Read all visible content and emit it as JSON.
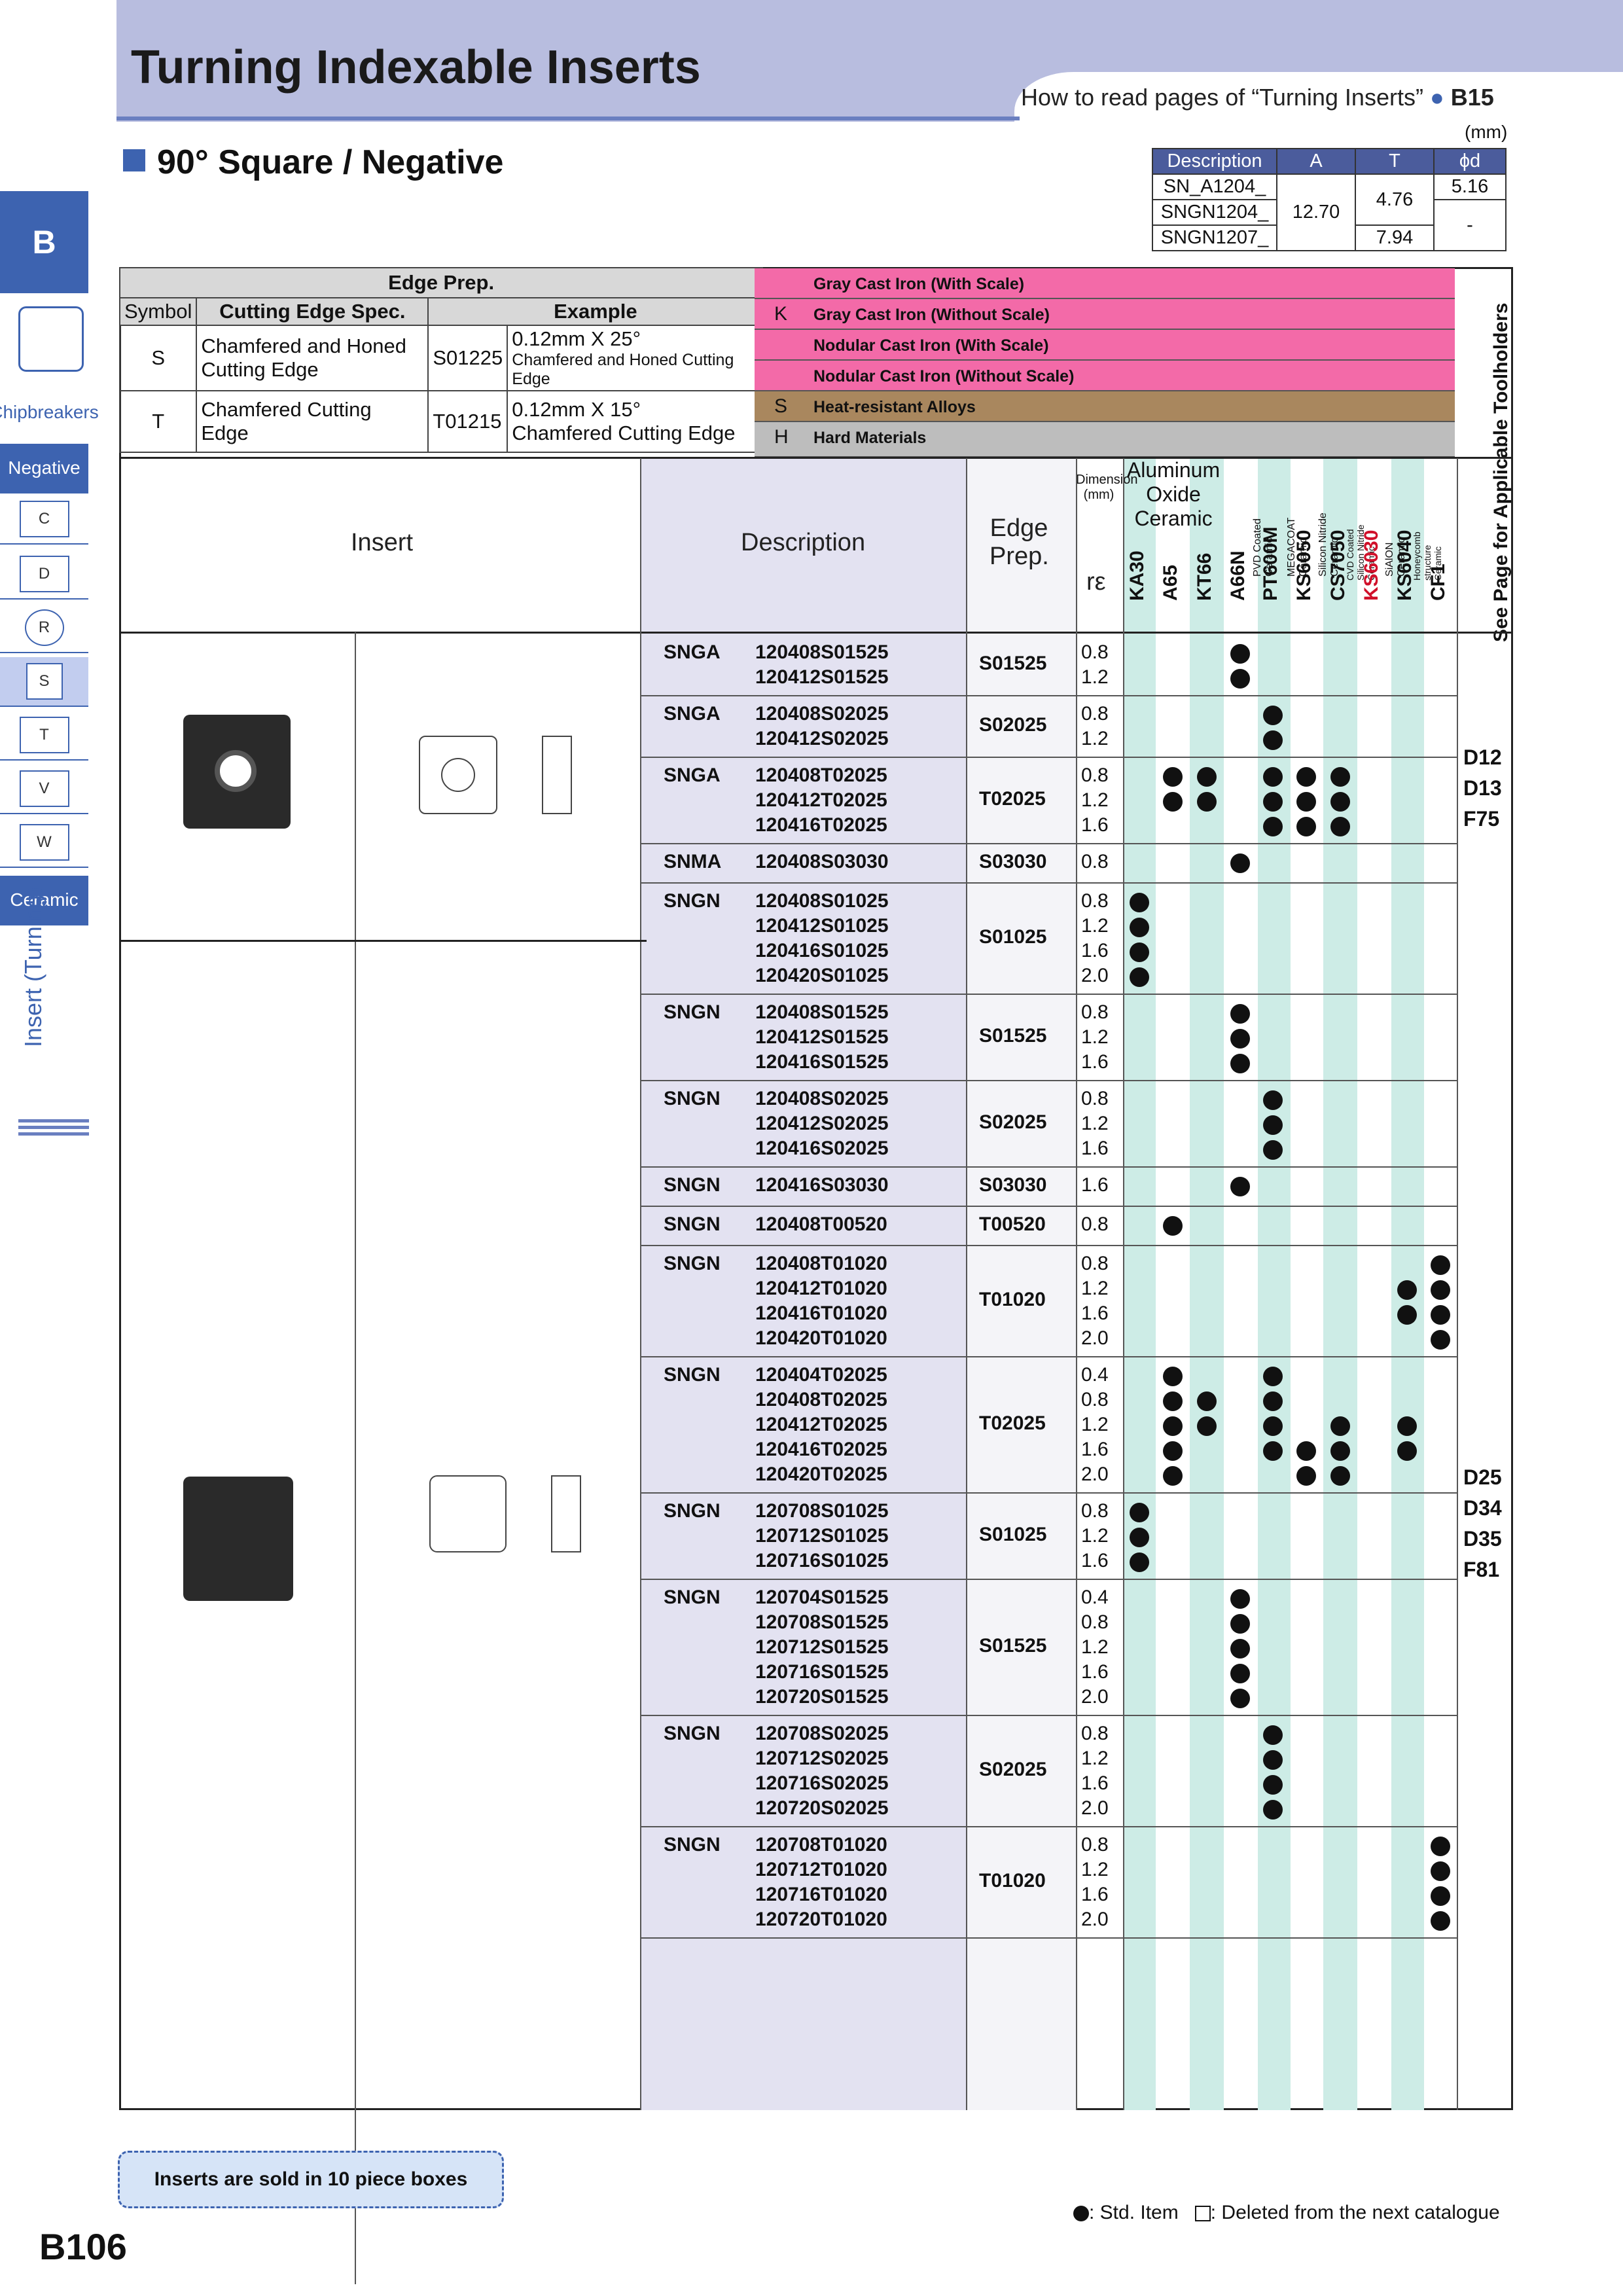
{
  "header": {
    "title": "Turning Indexable Inserts",
    "howto": "How to read pages of “Turning Inserts”",
    "howto_ref": "B15",
    "section": "90° Square / Negative",
    "unit": "(mm)"
  },
  "dims": {
    "headers": [
      "Description",
      "A",
      "T",
      "ϕd"
    ],
    "rows": [
      [
        "SN_A1204_",
        "12.70",
        "4.76",
        "5.16"
      ],
      [
        "SNGN1204_",
        "",
        "",
        "-"
      ],
      [
        "SNGN1207_",
        "",
        "7.94",
        ""
      ]
    ]
  },
  "sidebar": {
    "tab": "B",
    "chipbreakers": "Chipbreakers",
    "negative": "Negative",
    "shapes": [
      "C",
      "D",
      "R",
      "S",
      "T",
      "V",
      "W"
    ],
    "ceramic": "Ceramic",
    "vertical": "Insert (Turning)"
  },
  "edgeprep": {
    "title": "Edge Prep.",
    "col_symbol": "Symbol",
    "col_spec": "Cutting Edge Spec.",
    "col_example": "Example",
    "rows": [
      {
        "symbol": "S",
        "spec": "Chamfered and Honed Cutting Edge",
        "code": "S01225",
        "ex1": "0.12mm X 25°",
        "ex2": "Chamfered and Honed Cutting Edge"
      },
      {
        "symbol": "T",
        "spec": "Chamfered Cutting Edge",
        "code": "T01215",
        "ex1": "0.12mm X 15°",
        "ex2": "Chamfered Cutting Edge"
      }
    ]
  },
  "materials": [
    {
      "letter": "K",
      "name": "Gray Cast Iron (With Scale)"
    },
    {
      "letter": "",
      "name": "Gray Cast Iron (Without Scale)"
    },
    {
      "letter": "",
      "name": "Nodular Cast Iron (With Scale)"
    },
    {
      "letter": "",
      "name": "Nodular Cast Iron (Without Scale)"
    },
    {
      "letter": "S",
      "name": "Heat-resistant Alloys"
    },
    {
      "letter": "H",
      "name": "Hard Materials"
    }
  ],
  "cols": {
    "insert": "Insert",
    "description": "Description",
    "edge": "Edge Prep.",
    "dim": "Dimension (mm)",
    "re": "rε",
    "alox": "Aluminum Oxide Ceramic",
    "pvd": "PVD Coated Ceramic",
    "mega": "MEGACOAT Ceramic",
    "sin": "Silicon Nitride Ceramic",
    "cvd": "CVD Coated Silicon Nitride Ceramic",
    "sialon": "SiAlON Ceramic",
    "honey": "Honeycomb structure Ceramic",
    "seepage": "See Page for Applicable Toolholders"
  },
  "grades": [
    "KA30",
    "A65",
    "KT66",
    "A66N",
    "PT600M",
    "KS6050",
    "CS7050",
    "KS6030",
    "KS6040",
    "CF1"
  ],
  "rows": [
    {
      "type": "SNGA",
      "codes": [
        "120408S01525",
        "120412S01525"
      ],
      "edge": "S01525",
      "re": [
        "0.8",
        "1.2"
      ],
      "dots": [
        [
          3
        ],
        [
          3
        ]
      ]
    },
    {
      "type": "SNGA",
      "codes": [
        "120408S02025",
        "120412S02025"
      ],
      "edge": "S02025",
      "re": [
        "0.8",
        "1.2"
      ],
      "dots": [
        [
          4
        ],
        [
          4
        ]
      ]
    },
    {
      "type": "SNGA",
      "codes": [
        "120408T02025",
        "120412T02025",
        "120416T02025"
      ],
      "edge": "T02025",
      "re": [
        "0.8",
        "1.2",
        "1.6"
      ],
      "dots": [
        [
          1,
          2,
          4,
          5,
          6
        ],
        [
          1,
          2,
          4,
          5,
          6
        ],
        [
          4,
          5,
          6
        ]
      ]
    },
    {
      "type": "SNMA",
      "codes": [
        "120408S03030"
      ],
      "edge": "S03030",
      "re": [
        "0.8"
      ],
      "dots": [
        [
          3
        ]
      ]
    },
    {
      "type": "SNGN",
      "codes": [
        "120408S01025",
        "120412S01025",
        "120416S01025",
        "120420S01025"
      ],
      "edge": "S01025",
      "re": [
        "0.8",
        "1.2",
        "1.6",
        "2.0"
      ],
      "dots": [
        [
          0
        ],
        [
          0
        ],
        [
          0
        ],
        [
          0
        ]
      ]
    },
    {
      "type": "SNGN",
      "codes": [
        "120408S01525",
        "120412S01525",
        "120416S01525"
      ],
      "edge": "S01525",
      "re": [
        "0.8",
        "1.2",
        "1.6"
      ],
      "dots": [
        [
          3
        ],
        [
          3
        ],
        [
          3
        ]
      ]
    },
    {
      "type": "SNGN",
      "codes": [
        "120408S02025",
        "120412S02025",
        "120416S02025"
      ],
      "edge": "S02025",
      "re": [
        "0.8",
        "1.2",
        "1.6"
      ],
      "dots": [
        [
          4
        ],
        [
          4
        ],
        [
          4
        ]
      ]
    },
    {
      "type": "SNGN",
      "codes": [
        "120416S03030"
      ],
      "edge": "S03030",
      "re": [
        "1.6"
      ],
      "dots": [
        [
          3
        ]
      ]
    },
    {
      "type": "SNGN",
      "codes": [
        "120408T00520"
      ],
      "edge": "T00520",
      "re": [
        "0.8"
      ],
      "dots": [
        [
          1
        ]
      ]
    },
    {
      "type": "SNGN",
      "codes": [
        "120408T01020",
        "120412T01020",
        "120416T01020",
        "120420T01020"
      ],
      "edge": "T01020",
      "re": [
        "0.8",
        "1.2",
        "1.6",
        "2.0"
      ],
      "dots": [
        [
          9
        ],
        [
          8,
          9
        ],
        [
          8,
          9
        ],
        [
          9
        ]
      ]
    },
    {
      "type": "SNGN",
      "codes": [
        "120404T02025",
        "120408T02025",
        "120412T02025",
        "120416T02025",
        "120420T02025"
      ],
      "edge": "T02025",
      "re": [
        "0.4",
        "0.8",
        "1.2",
        "1.6",
        "2.0"
      ],
      "dots": [
        [
          1,
          4
        ],
        [
          1,
          2,
          4
        ],
        [
          1,
          2,
          4,
          6,
          8
        ],
        [
          1,
          4,
          5,
          6,
          8
        ],
        [
          1,
          5,
          6
        ]
      ]
    },
    {
      "type": "SNGN",
      "codes": [
        "120708S01025",
        "120712S01025",
        "120716S01025"
      ],
      "edge": "S01025",
      "re": [
        "0.8",
        "1.2",
        "1.6"
      ],
      "dots": [
        [
          0
        ],
        [
          0
        ],
        [
          0
        ]
      ]
    },
    {
      "type": "SNGN",
      "codes": [
        "120704S01525",
        "120708S01525",
        "120712S01525",
        "120716S01525",
        "120720S01525"
      ],
      "edge": "S01525",
      "re": [
        "0.4",
        "0.8",
        "1.2",
        "1.6",
        "2.0"
      ],
      "dots": [
        [
          3
        ],
        [
          3
        ],
        [
          3
        ],
        [
          3
        ],
        [
          3
        ]
      ]
    },
    {
      "type": "SNGN",
      "codes": [
        "120708S02025",
        "120712S02025",
        "120716S02025",
        "120720S02025"
      ],
      "edge": "S02025",
      "re": [
        "0.8",
        "1.2",
        "1.6",
        "2.0"
      ],
      "dots": [
        [
          4
        ],
        [
          4
        ],
        [
          4
        ],
        [
          4
        ]
      ]
    },
    {
      "type": "SNGN",
      "codes": [
        "120708T01020",
        "120712T01020",
        "120716T01020",
        "120720T01020"
      ],
      "edge": "T01020",
      "re": [
        "0.8",
        "1.2",
        "1.6",
        "2.0"
      ],
      "dots": [
        [
          9
        ],
        [
          9
        ],
        [
          9
        ],
        [
          9
        ]
      ]
    }
  ],
  "toolholders": {
    "group1": [
      "D12",
      "D13",
      "F75"
    ],
    "group2": [
      "D25",
      "D34",
      "D35",
      "F81"
    ]
  },
  "legend": {
    "std": ": Std. Item",
    "deleted": ": Deleted from the next catalogue"
  },
  "note": "Inserts are sold in 10 piece boxes",
  "page": "B106"
}
